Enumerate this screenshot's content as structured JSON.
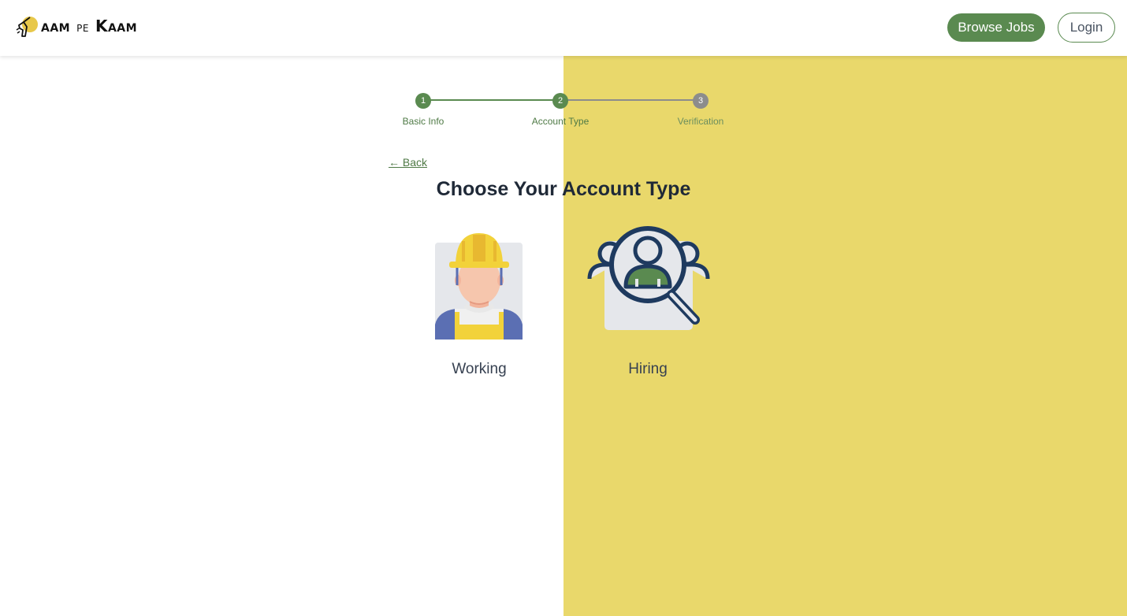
{
  "app": {
    "logo_parts": {
      "a": "AAM",
      "pe": "PE",
      "k": "K",
      "k_rest": "AAM"
    }
  },
  "nav": {
    "browse_label": "Browse Jobs",
    "login_label": "Login"
  },
  "stepper": {
    "steps": [
      {
        "number": "1",
        "label": "Basic Info",
        "state": "complete"
      },
      {
        "number": "2",
        "label": "Account Type",
        "state": "current"
      },
      {
        "number": "3",
        "label": "Verification",
        "state": "pending"
      }
    ]
  },
  "content": {
    "back_label": "← Back",
    "title": "Choose Your Account Type",
    "options": [
      {
        "label": "Working",
        "icon": "construction-worker-icon"
      },
      {
        "label": "Hiring",
        "icon": "people-search-icon"
      }
    ]
  },
  "colors": {
    "accent_green": "#5a8a50",
    "panel_yellow": "#e9d86b",
    "step_pending": "#8c8c8c"
  }
}
